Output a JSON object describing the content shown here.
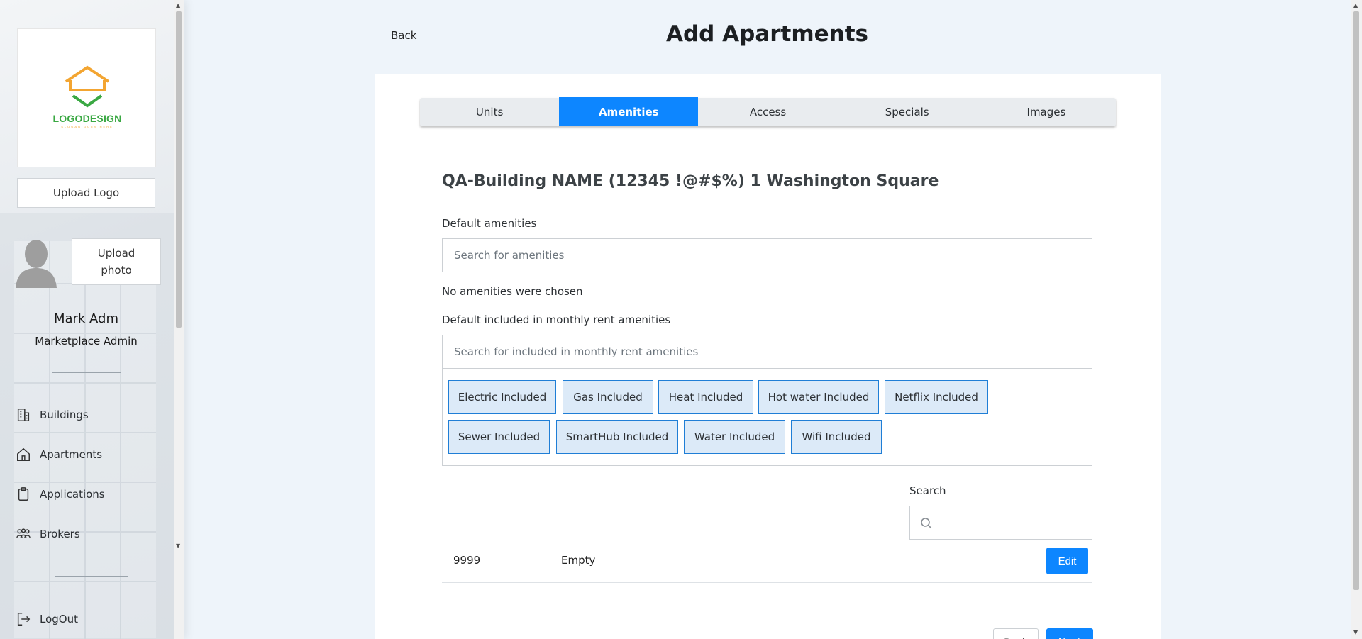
{
  "sidebar": {
    "logo_text": "LOGODESIGN",
    "logo_slogan": "SLOGAN GOES HERE",
    "upload_logo": "Upload Logo",
    "upload_photo_line1": "Upload",
    "upload_photo_line2": "photo",
    "user_name": "Mark Adm",
    "user_role": "Marketplace Admin",
    "nav": [
      {
        "label": "Buildings",
        "icon": "building-icon"
      },
      {
        "label": "Apartments",
        "icon": "home-icon"
      },
      {
        "label": "Applications",
        "icon": "clipboard-icon"
      },
      {
        "label": "Brokers",
        "icon": "people-icon"
      }
    ],
    "logout": "LogOut"
  },
  "header": {
    "back": "Back",
    "title": "Add Apartments"
  },
  "tabs": [
    "Units",
    "Amenities",
    "Access",
    "Specials",
    "Images"
  ],
  "active_tab": "Amenities",
  "main": {
    "building_name": "QA-Building NAME (12345 !@#$%) 1 Washington Square",
    "default_amenities_label": "Default amenities",
    "default_amenities_placeholder": "Search for amenities",
    "no_amenities": "No amenities were chosen",
    "included_label": "Default included in monthly rent amenities",
    "included_placeholder": "Search for included in monthly rent amenities",
    "included_chips": [
      "Electric Included",
      "Gas Included",
      "Heat Included",
      "Hot water Included",
      "Netflix Included",
      "Sewer Included",
      "SmartHub Included",
      "Water Included",
      "Wifi Included"
    ],
    "search_label": "Search",
    "search_value": "",
    "row": {
      "unit": "9999",
      "status": "Empty",
      "edit": "Edit"
    },
    "back_button": "Back",
    "next_button": "Next"
  },
  "colors": {
    "accent": "#0d86ff",
    "chip_bg": "#dceaf8",
    "chip_border": "#1f7ed6",
    "page_bg": "#eef4fa"
  }
}
